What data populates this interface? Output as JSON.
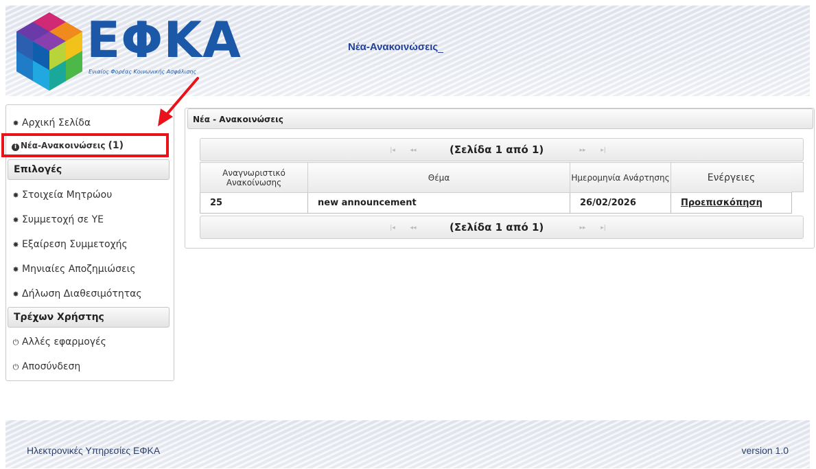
{
  "header": {
    "logo_text": "ΕΦΚΑ",
    "logo_subtitle": "Ενιαίος Φορέας Κοινωνικής Ασφάλισης",
    "page_title": "Νέα-Ανακοινώσεις"
  },
  "sidebar": {
    "home": {
      "label": "Αρχική Σελίδα",
      "icon": "gear-icon"
    },
    "announcements": {
      "label": "Νέα-Ανακοινώσεις",
      "count": "(1)",
      "icon": "info-icon"
    },
    "options_header": "Επιλογές",
    "options": [
      {
        "label": "Στοιχεία Μητρώου",
        "icon": "gear-icon"
      },
      {
        "label": "Συμμετοχή σε ΥΕ",
        "icon": "gear-icon"
      },
      {
        "label": "Εξαίρεση Συμμετοχής",
        "icon": "gear-icon"
      },
      {
        "label": "Μηνιαίες Αποζημιώσεις",
        "icon": "gear-icon"
      },
      {
        "label": "Δήλωση Διαθεσιμότητας",
        "icon": "gear-icon"
      }
    ],
    "user_header": "Τρέχων Χρήστης",
    "user_items": [
      {
        "label": "Αλλές εφαρμογές",
        "icon": "power-icon"
      },
      {
        "label": "Αποσύνδεση",
        "icon": "power-icon"
      }
    ]
  },
  "annotation": {
    "highlight_color": "#e8121a"
  },
  "main": {
    "panel_title": "Νέα - Ανακοινώσεις",
    "pager_label": "(Σελίδα 1 από 1)",
    "columns": [
      "Αναγνωριστικό Ανακοίνωσης",
      "Θέμα",
      "Ημερομηνία Ανάρτησης",
      "Ενέργειες"
    ],
    "rows": [
      {
        "id": "25",
        "subject": "new announcement",
        "date": "26/02/2026",
        "action": "Προεπισκόπηση"
      }
    ]
  },
  "footer": {
    "left": "Ηλεκτρονικές Υπηρεσίες ΕΦΚΑ",
    "right": "version 1.0"
  },
  "colors": {
    "brand_blue": "#1c58a8",
    "title_blue": "#1f3f9a",
    "highlight_red": "#e8121a"
  }
}
